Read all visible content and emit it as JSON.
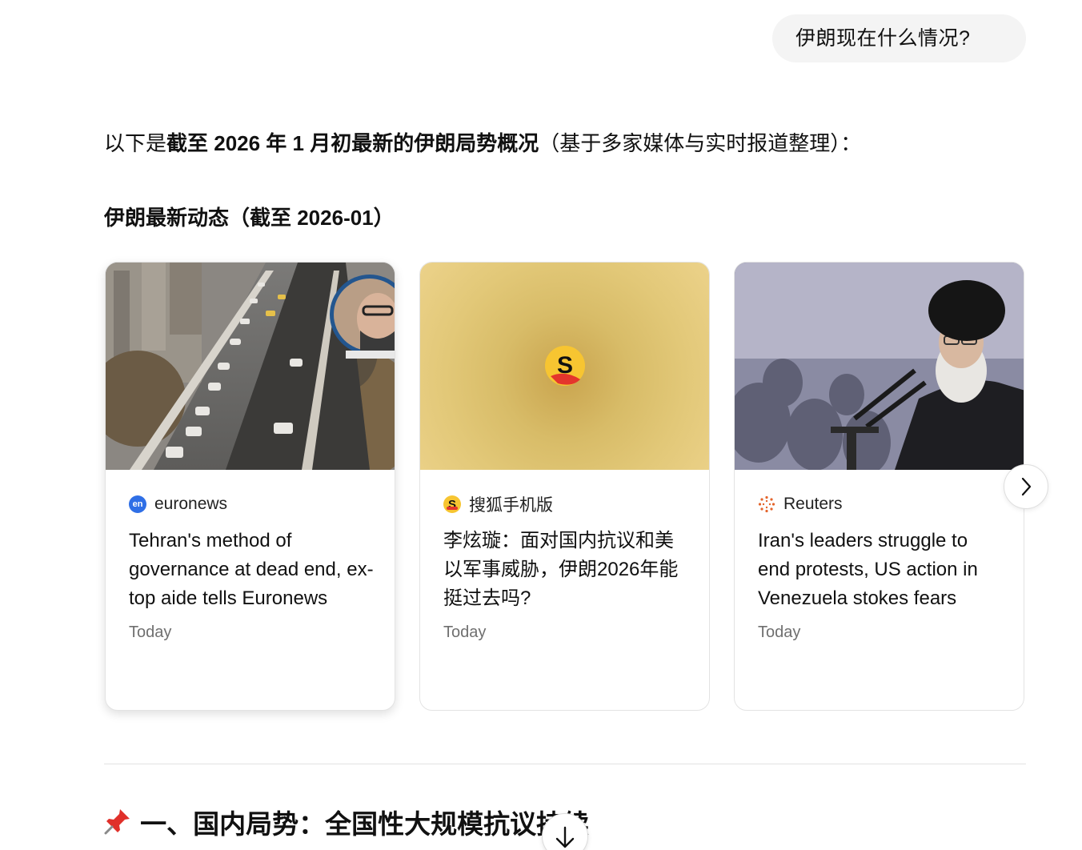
{
  "user_message": "伊朗现在什么情况?",
  "intro": {
    "prefix": "以下是",
    "bold": "截至 2026 年 1 月初最新的伊朗局势概况",
    "suffix": "（基于多家媒体与实时报道整理）："
  },
  "news_section": {
    "heading": "伊朗最新动态（截至 2026-01）",
    "cards": [
      {
        "source": "euronews",
        "source_icon": "euronews-logo-icon",
        "source_icon_text": "en",
        "title": "Tehran's method of governance at dead end, ex-top aide tells Euronews",
        "date": "Today"
      },
      {
        "source": "搜狐手机版",
        "source_icon": "sohu-logo-icon",
        "source_icon_text": "S",
        "title": "李炫璇：面对国内抗议和美以军事威胁，伊朗2026年能挺过去吗?",
        "date": "Today"
      },
      {
        "source": "Reuters",
        "source_icon": "reuters-logo-icon",
        "title": "Iran's leaders struggle to end protests, US action in Venezuela stokes fears",
        "date": "Today"
      }
    ]
  },
  "section_2": {
    "icon": "pushpin-icon",
    "heading": "一、国内局势：全国性大规模抗议持续"
  },
  "colors": {
    "user_bubble_bg": "#f4f4f4",
    "euronews_blue": "#2f6fe6",
    "sohu_yellow": "#f7c531",
    "reuters_orange": "#e3642b"
  }
}
